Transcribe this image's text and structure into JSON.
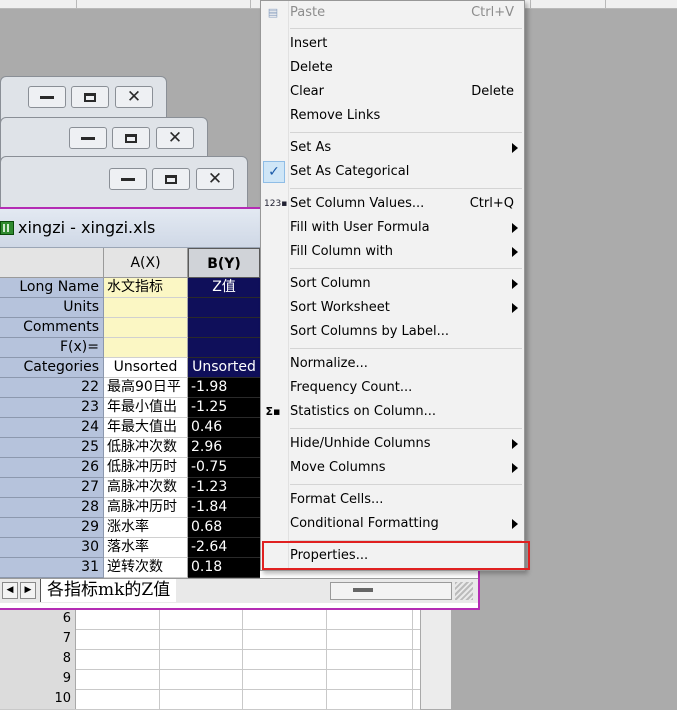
{
  "worksheet": {
    "title": "xingzi - xingzi.xls",
    "col_a_header": "A(X)",
    "col_b_header": "B(Y)",
    "meta_rows": [
      {
        "label": "Long Name",
        "a": "水文指标",
        "b": "Z值"
      },
      {
        "label": "Units",
        "a": "",
        "b": ""
      },
      {
        "label": "Comments",
        "a": "",
        "b": ""
      },
      {
        "label": "F(x)=",
        "a": "",
        "b": ""
      },
      {
        "label": "Categories",
        "a": "Unsorted",
        "b": "Unsorted"
      }
    ],
    "data_rows": [
      {
        "num": "22",
        "a": "最高90日平",
        "b": "-1.98"
      },
      {
        "num": "23",
        "a": "年最小值出",
        "b": "-1.25"
      },
      {
        "num": "24",
        "a": "年最大值出",
        "b": "0.46"
      },
      {
        "num": "25",
        "a": "低脉冲次数",
        "b": "2.96"
      },
      {
        "num": "26",
        "a": "低脉冲历时",
        "b": "-0.75"
      },
      {
        "num": "27",
        "a": "高脉冲次数",
        "b": "-1.23"
      },
      {
        "num": "28",
        "a": "高脉冲历时",
        "b": "-1.84"
      },
      {
        "num": "29",
        "a": "涨水率",
        "b": "0.68"
      },
      {
        "num": "30",
        "a": "落水率",
        "b": "-2.64"
      },
      {
        "num": "31",
        "a": "逆转次数",
        "b": "0.18"
      }
    ],
    "sheet_tab": "各指标mk的Z值"
  },
  "back_worksheet": {
    "rows": [
      "6",
      "7",
      "8",
      "9",
      "10"
    ]
  },
  "context_menu": {
    "paste": {
      "label": "Paste",
      "shortcut": "Ctrl+V"
    },
    "insert": "Insert",
    "delete": "Delete",
    "clear": {
      "label": "Clear",
      "shortcut": "Delete"
    },
    "remove_links": "Remove Links",
    "set_as": "Set As",
    "set_as_categorical": "Set As Categorical",
    "set_column_values": {
      "label": "Set Column Values...",
      "shortcut": "Ctrl+Q"
    },
    "fill_with_user_formula": "Fill with User Formula",
    "fill_column_with": "Fill Column with",
    "sort_column": "Sort Column",
    "sort_worksheet": "Sort Worksheet",
    "sort_columns_by_label": "Sort Columns by Label...",
    "normalize": "Normalize...",
    "frequency_count": "Frequency Count...",
    "statistics_on_column": "Statistics on Column...",
    "hide_unhide_columns": "Hide/Unhide Columns",
    "move_columns": "Move Columns",
    "format_cells": "Format Cells...",
    "conditional_formatting": "Conditional Formatting",
    "properties": "Properties...",
    "icons": {
      "paste": "paste-icon",
      "checked": "check-icon",
      "set_values": "set-values-icon",
      "statistics": "sigma-icon"
    }
  },
  "colors": {
    "selected_column": "#0f0f5a",
    "window_border": "#b42cb4",
    "highlight": "#e02020"
  }
}
